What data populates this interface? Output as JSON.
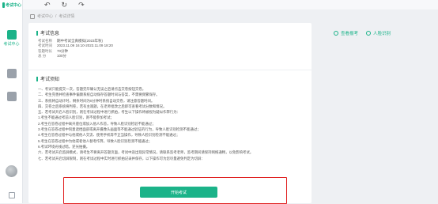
{
  "app": {
    "logo_text": "考试中心"
  },
  "rail": {
    "items": [
      {
        "label": "考试中心",
        "active": true
      },
      {
        "label": "",
        "active": false
      },
      {
        "label": "",
        "active": false
      }
    ]
  },
  "toolbar": {
    "back": "↶",
    "refresh": "↻",
    "forward": "↷"
  },
  "breadcrumb": [
    "考试中心",
    "考试详情"
  ],
  "exam_info": {
    "title": "考试信息",
    "rows": [
      {
        "k": "考试名称",
        "v": "期中考试全真模拟(2023年秋)"
      },
      {
        "k": "考试时间",
        "v": "2023.11.09 16:10-2023.11.09 18:20"
      },
      {
        "k": "答题时长",
        "v": "70分钟"
      },
      {
        "k": "总 分",
        "v": "100分"
      }
    ]
  },
  "notes": {
    "title": "考试须知",
    "lines": [
      "一、考试只能提交一次，答题完毕确认无误之后请点击交卷按钮交卷。",
      "二、考生完善并检查事件偏颇系统自动保存答题时间与答案，不需要频繁保存。",
      "三、系统将自动计时，剩余时间为0分钟时系统自动交卷，请注意答题时间。",
      "四、交卷之后系统将判卷，若有主观题，在老师批改之后即可查看考试分数和情况。",
      "五、若考试开启人脸识别，则在考试过程中进行抓拍，考生以下操作将被视为疑似作弊行为：",
      "1.考生不能通过考前人脸识别，则不能参加考试；",
      "2.考生在答卷过程中离开座位或加入他人作答，导致人脸识别检验不能通过；",
      "3.考生在答卷过程中刻意遮挡面部或离开摄像头画面等不能通过验证的行为，导致人脸识别检测不能通过；",
      "4.考生在答卷过程中与他或他人交流、使用手机等不正当操作，导致人脸识别检测不能通过；",
      "5.考生在答卷过程中为他或者他人替考作弊，导致人脸识别检测不能通过；",
      "6.考试环境光线过暗，逆光拍摄。",
      "六、若考试开启监屏模式，请考生不要离开答题页面，考试中途出现异常情况，请联系监考老师，监考期间请保持网络通畅，以免影响考试。",
      "七、若考试开启切屏限制，则在考试过程中实时进行抓拍记录并保存，以下操作可为您尽量避免判定为切屏："
    ]
  },
  "start_button": "开始考试",
  "right_links": {
    "doc": "查看报考",
    "face": "人脸识别"
  }
}
